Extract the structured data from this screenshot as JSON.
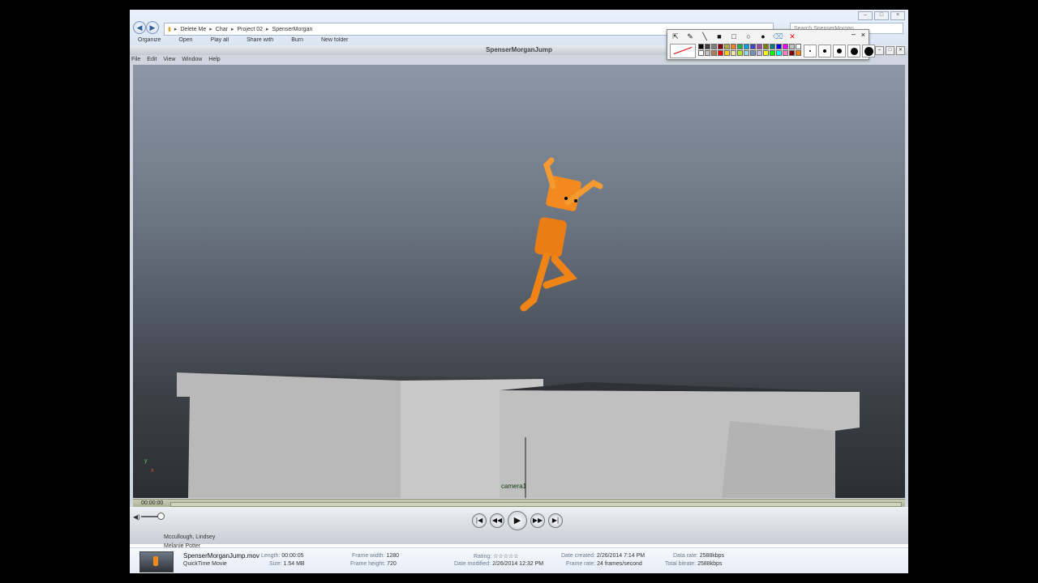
{
  "explorer": {
    "breadcrumb": [
      "Delete Me",
      "Char",
      "Project 02",
      "SpenserMorgan"
    ],
    "search_placeholder": "Search SpenserMorgan",
    "commands": [
      "Organize",
      "Open",
      "Play all",
      "Share with",
      "Burn",
      "New folder"
    ]
  },
  "paint_toolbar": {
    "tools": [
      "select-icon",
      "pencil-icon",
      "line-icon",
      "rect-filled-icon",
      "rect-icon",
      "ellipse-icon",
      "ellipse-filled-icon",
      "eraser-icon",
      "close-icon"
    ],
    "palette": [
      "#000000",
      "#404040",
      "#7f7f7f",
      "#880015",
      "#b5a642",
      "#ff7f27",
      "#22b14c",
      "#00a2e8",
      "#3f48cc",
      "#a349a4",
      "#808000",
      "#008080",
      "#0000ff",
      "#ff00ff",
      "#c0c0c0",
      "#ffffff",
      "#ffffff",
      "#c3c3c3",
      "#b97a57",
      "#ff0000",
      "#ffc90e",
      "#efe4b0",
      "#b5e61d",
      "#99d9ea",
      "#7092be",
      "#c8bfe7",
      "#ffff00",
      "#00ff00",
      "#00ffff",
      "#ff80c0",
      "#800000",
      "#ff8000"
    ]
  },
  "player": {
    "title": "SpenserMorganJump",
    "menu": [
      "File",
      "Edit",
      "View",
      "Window",
      "Help"
    ],
    "camera_label": "camera1",
    "current_time": "00:00:00",
    "axis_label_x": "x",
    "axis_label_y": "y"
  },
  "list_items": [
    "Mccullough, Lindsey",
    "Melanie Potter"
  ],
  "details": {
    "file_name": "SpenserMorganJump.mov",
    "file_type": "QuickTime Movie",
    "length_label": "Length:",
    "length": "00:00:05",
    "size_label": "Size:",
    "size": "1.54 MB",
    "frame_width_label": "Frame width:",
    "frame_width": "1280",
    "frame_height_label": "Frame height:",
    "frame_height": "720",
    "rating_label": "Rating:",
    "rating_stars": "☆☆☆☆☆",
    "date_modified_label": "Date modified:",
    "date_modified": "2/26/2014 12:32 PM",
    "date_created_label": "Date created:",
    "date_created": "2/26/2014 7:14 PM",
    "frame_rate_label": "Frame rate:",
    "frame_rate": "24 frames/second",
    "data_rate_label": "Data rate:",
    "data_rate": "2588kbps",
    "total_bitrate_label": "Total bitrate:",
    "total_bitrate": "2588kbps"
  }
}
